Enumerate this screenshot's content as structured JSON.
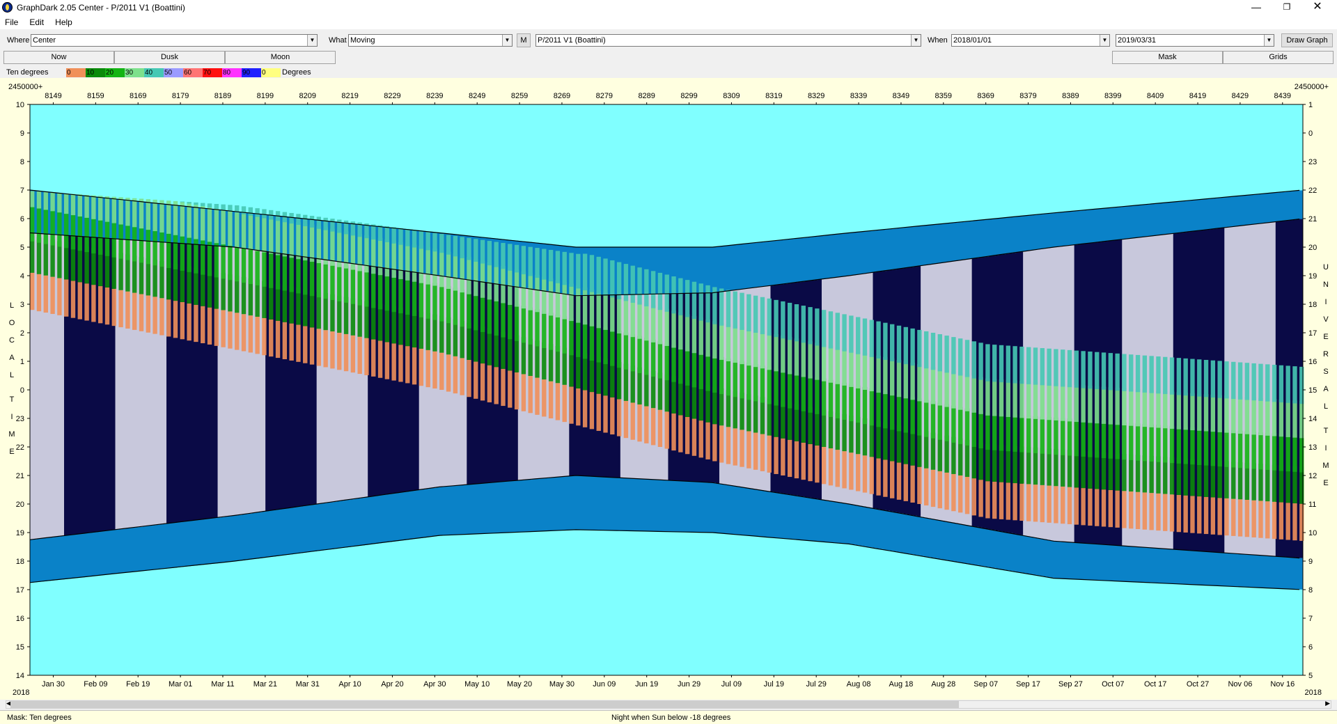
{
  "window": {
    "title": "GraphDark 2.05  Center  -  P/2011 V1 (Boattini)"
  },
  "menu": [
    "File",
    "Edit",
    "Help"
  ],
  "toolbar": {
    "where_label": "Where",
    "where_value": "Center",
    "what_label": "What",
    "what_value": "Moving",
    "m_button": "M",
    "object_value": "P/2011 V1 (Boattini)",
    "when_label": "When",
    "start_date": "2018/01/01",
    "end_date": "2019/03/31",
    "draw_button": "Draw Graph"
  },
  "tabs": {
    "now": "Now",
    "dusk": "Dusk",
    "moon": "Moon",
    "mask": "Mask",
    "grids": "Grids"
  },
  "legend": {
    "label": "Ten degrees",
    "unit": "Degrees",
    "items": [
      {
        "label": "0",
        "color": "#f0905a"
      },
      {
        "label": "10",
        "color": "#0a8a0a"
      },
      {
        "label": "20",
        "color": "#14b414"
      },
      {
        "label": "30",
        "color": "#7de08c"
      },
      {
        "label": "40",
        "color": "#46c8b4"
      },
      {
        "label": "50",
        "color": "#9b9bff"
      },
      {
        "label": "60",
        "color": "#ff7474"
      },
      {
        "label": "70",
        "color": "#ff1010"
      },
      {
        "label": "80",
        "color": "#ff32ff"
      },
      {
        "label": "90",
        "color": "#2020ff"
      },
      {
        "label": "0",
        "color": "#ffff80"
      }
    ]
  },
  "chart_data": {
    "type": "heatmap",
    "corner_top_left": "2450000+",
    "corner_top_right": "2450000+",
    "year_left": "2018",
    "year_right": "2018",
    "left_axis_title": "LOCAL TIME",
    "right_axis_title": "UNIVERSAL TIME",
    "jd_ticks": [
      "8149",
      "8159",
      "8169",
      "8179",
      "8189",
      "8199",
      "8209",
      "8219",
      "8229",
      "8239",
      "8249",
      "8259",
      "8269",
      "8279",
      "8289",
      "8299",
      "8309",
      "8319",
      "8329",
      "8339",
      "8349",
      "8359",
      "8369",
      "8379",
      "8389",
      "8399",
      "8409",
      "8419",
      "8429",
      "8439"
    ],
    "date_ticks": [
      "Jan 30",
      "Feb 09",
      "Feb 19",
      "Mar 01",
      "Mar 11",
      "Mar 21",
      "Mar 31",
      "Apr 10",
      "Apr 20",
      "Apr 30",
      "May 10",
      "May 20",
      "May 30",
      "Jun 09",
      "Jun 19",
      "Jun 29",
      "Jul 09",
      "Jul 19",
      "Jul 29",
      "Aug 08",
      "Aug 18",
      "Aug 28",
      "Sep 07",
      "Sep 17",
      "Sep 27",
      "Oct 07",
      "Oct 17",
      "Oct 27",
      "Nov 06",
      "Nov 16"
    ],
    "local_time_ticks": [
      "10",
      "9",
      "8",
      "7",
      "6",
      "5",
      "4",
      "3",
      "2",
      "1",
      "0",
      "23",
      "22",
      "21",
      "20",
      "19",
      "18",
      "17",
      "16",
      "15",
      "14"
    ],
    "ut_ticks": [
      "1",
      "0",
      "23",
      "22",
      "21",
      "20",
      "19",
      "18",
      "17",
      "16",
      "15",
      "14",
      "13",
      "12",
      "11",
      "10",
      "9",
      "8",
      "7",
      "6",
      "5"
    ],
    "colors": {
      "day": "#80ffff",
      "twilight": "#0a82c8",
      "moonlit": "#c8c8dc",
      "dark": "#0a0a46",
      "band_0": "#f0905a",
      "band_10": "#0a8a0a",
      "band_20": "#14b414",
      "band_30": "#7de08c",
      "band_40": "#46c8b4"
    }
  },
  "status": {
    "mask": "Mask:  Ten degrees",
    "night": "Night when Sun below -18 degrees"
  }
}
